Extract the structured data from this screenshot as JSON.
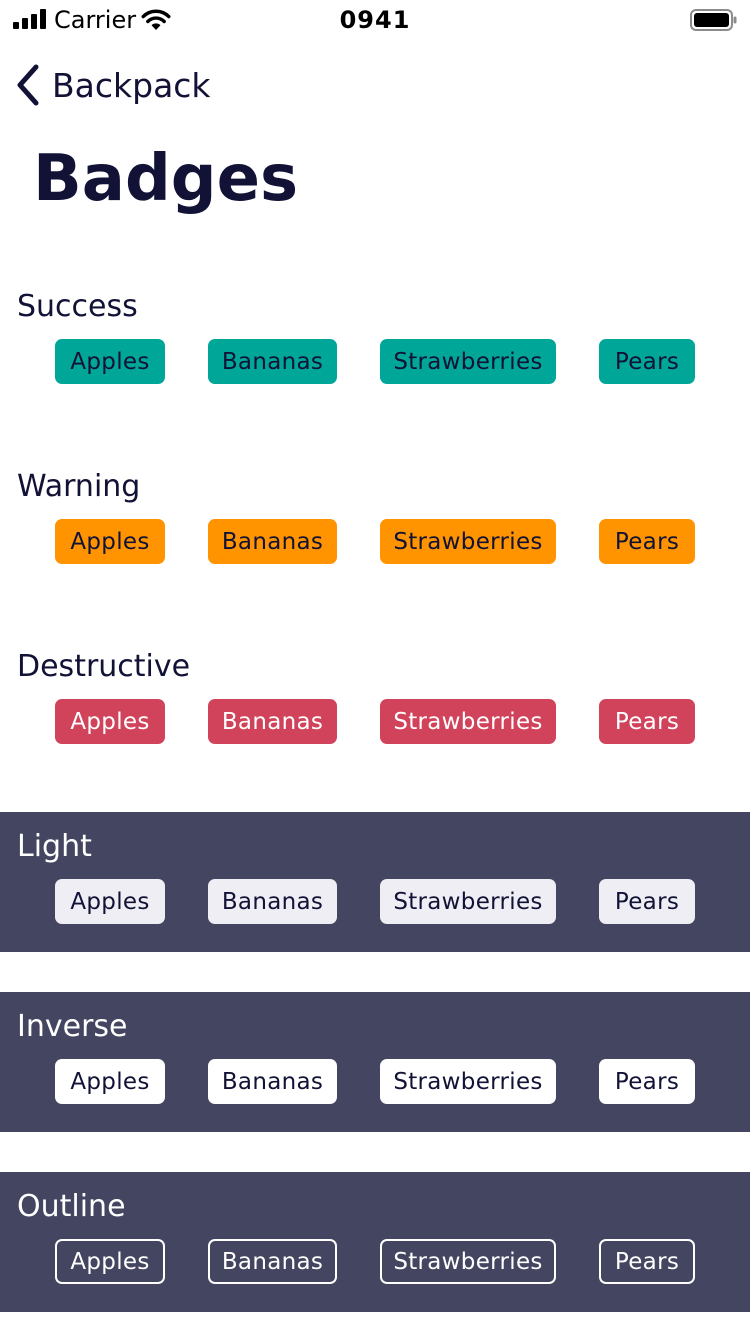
{
  "status_bar": {
    "carrier": "Carrier",
    "time": "0941"
  },
  "nav": {
    "back_label": "Backpack"
  },
  "page": {
    "title": "Badges"
  },
  "sections": [
    {
      "title": "Success",
      "badges": [
        "Apples",
        "Bananas",
        "Strawberries",
        "Pears"
      ]
    },
    {
      "title": "Warning",
      "badges": [
        "Apples",
        "Bananas",
        "Strawberries",
        "Pears"
      ]
    },
    {
      "title": "Destructive",
      "badges": [
        "Apples",
        "Bananas",
        "Strawberries",
        "Pears"
      ]
    },
    {
      "title": "Light",
      "badges": [
        "Apples",
        "Bananas",
        "Strawberries",
        "Pears"
      ]
    },
    {
      "title": "Inverse",
      "badges": [
        "Apples",
        "Bananas",
        "Strawberries",
        "Pears"
      ]
    },
    {
      "title": "Outline",
      "badges": [
        "Apples",
        "Bananas",
        "Strawberries",
        "Pears"
      ]
    }
  ],
  "icons": {
    "signal": "cellular-signal-icon",
    "wifi": "wifi-icon",
    "battery": "battery-icon",
    "back": "chevron-left-icon"
  },
  "colors": {
    "text_primary": "#111236",
    "success": "#00a698",
    "warning": "#ff9400",
    "destructive": "#d1435b",
    "light": "#eeeef4",
    "inverse": "#ffffff",
    "dark_background": "#444560"
  }
}
